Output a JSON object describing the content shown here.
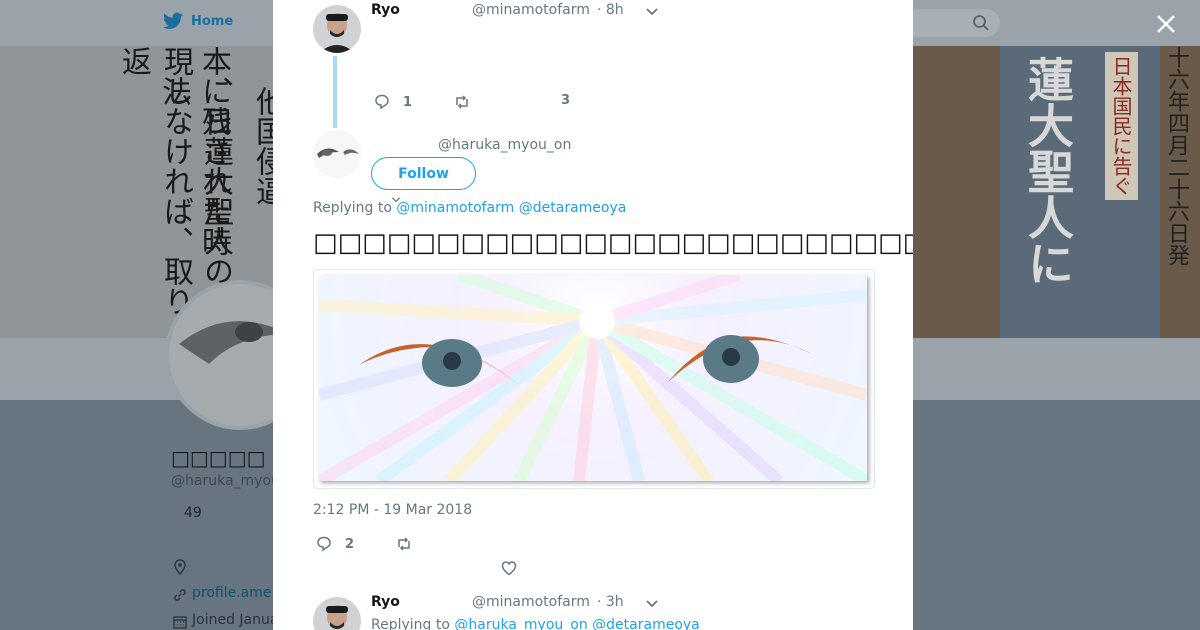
{
  "nav": {
    "home_label": "Home"
  },
  "background_profile": {
    "name": "□□□□□ □□□",
    "handle": "@haruka_myou",
    "count": "49",
    "link": "profile.ame",
    "joined": "Joined Janua",
    "banner_left_cols": [
      "現しなければ、取り返",
      "、日蓮大聖人の仏法",
      "本に残された時",
      "他国侵逼"
    ],
    "poster_title": "蓮大聖人に",
    "poster_sub": "日本国民に告ぐ",
    "banner_right_col": "十六年四月二十六日発"
  },
  "tweets": [
    {
      "name": "Ryo",
      "handle": "@minamotofarm",
      "time": "· 8h",
      "reply_count": "1",
      "like_count": "3"
    },
    {
      "handle": "@haruka_myou_on",
      "follow_label": "Follow",
      "replying_prefix": "Replying to",
      "mention_1": "@minamotofarm",
      "mention_2": "@detarameoya",
      "text": "□□□□□□□□□□□□□□□□□□□□□□□□□□□□□□□□□",
      "timestamp": "2:12 PM - 19 Mar 2018",
      "reply_count": "2"
    },
    {
      "name": "Ryo",
      "handle": "@minamotofarm",
      "time": "· 3h",
      "replying_prefix": "Replying to",
      "mention_1": "@haruka_myou_on",
      "mention_2": "@detarameoya"
    }
  ],
  "colors": {
    "accent": "#1da1f2",
    "thread": "#a9d9f3",
    "muted": "#657786"
  }
}
